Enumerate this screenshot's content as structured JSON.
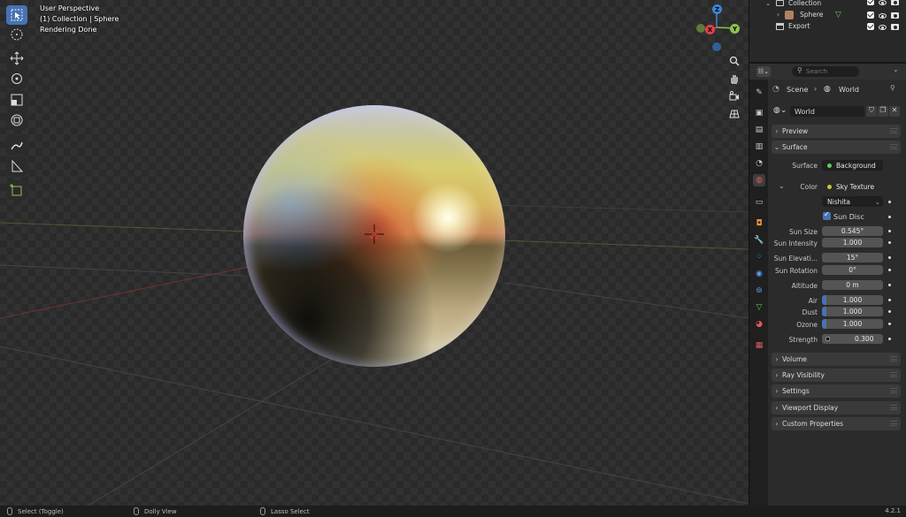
{
  "viewport": {
    "perspective": "User Perspective",
    "collection_path": "(1) Collection | Sphere",
    "status": "Rendering Done"
  },
  "gizmo": {
    "z": "Z",
    "y": "Y",
    "x": "X"
  },
  "outliner": {
    "rows": [
      {
        "label": "Collection"
      },
      {
        "label": "Sphere"
      },
      {
        "label": "Export"
      }
    ]
  },
  "properties": {
    "search_placeholder": "Search",
    "breadcrumb": {
      "scene": "Scene",
      "world": "World"
    },
    "world_name": "World",
    "panels": {
      "preview": "Preview",
      "surface": "Surface",
      "volume": "Volume",
      "ray_visibility": "Ray Visibility",
      "settings": "Settings",
      "viewport_display": "Viewport Display",
      "custom_properties": "Custom Properties"
    },
    "surface": {
      "surface_label": "Surface",
      "surface_value": "Background",
      "color_label": "Color",
      "color_value": "Sky Texture",
      "sky_type": "Nishita",
      "sun_disc_label": "Sun Disc",
      "sun_disc_checked": true,
      "fields": [
        {
          "label": "Sun Size",
          "value": "0.545°"
        },
        {
          "label": "Sun Intensity",
          "value": "1.000"
        },
        {
          "label": "Sun Elevati...",
          "value": "15°"
        },
        {
          "label": "Sun Rotation",
          "value": "0°"
        },
        {
          "label": "Altitude",
          "value": "0 m"
        },
        {
          "label": "Air",
          "value": "1.000"
        },
        {
          "label": "Dust",
          "value": "1.000"
        },
        {
          "label": "Ozone",
          "value": "1.000"
        },
        {
          "label": "Strength",
          "value": "0.300"
        }
      ]
    }
  },
  "statusbar": {
    "select": "Select (Toggle)",
    "dolly": "Dolly View",
    "lasso": "Lasso Select",
    "version": "4.2.1"
  },
  "colors": {
    "accent": "#4772b3",
    "axis_x": "#e0404f",
    "axis_y": "#8bc34a",
    "axis_z": "#3d85d6",
    "socket_green": "#63c763",
    "socket_yellow": "#c7c729"
  }
}
